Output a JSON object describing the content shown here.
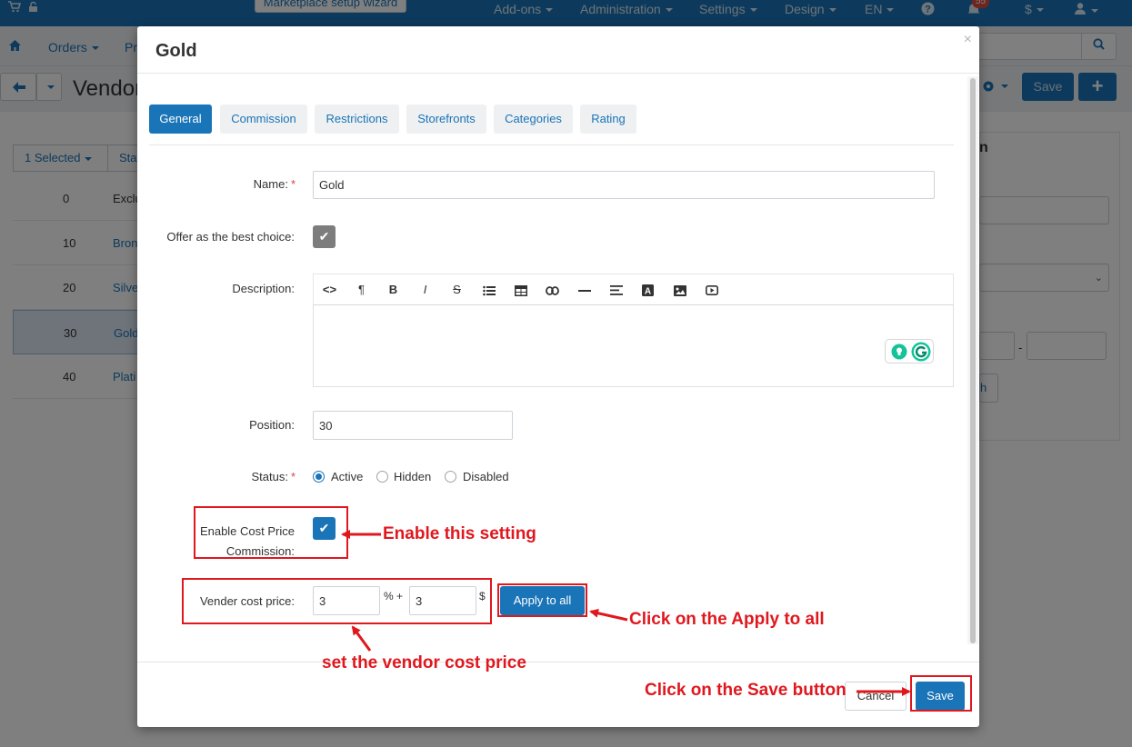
{
  "topbar": {
    "wizard_label": "Marketplace setup wizard",
    "addons": "Add-ons",
    "administration": "Administration",
    "settings": "Settings",
    "design": "Design",
    "language": "EN",
    "notifications_count": "55",
    "currency": "$"
  },
  "subbar": {
    "orders": "Orders",
    "products_partial": "Pr"
  },
  "page": {
    "title": "Vendor",
    "save_label": "Save",
    "selected_label": "1 Selected",
    "status_partial": "Sta"
  },
  "bg_rows": [
    {
      "position": "0",
      "name": "Exclu"
    },
    {
      "position": "10",
      "name": "Bron"
    },
    {
      "position": "20",
      "name": "Silve"
    },
    {
      "position": "30",
      "name": "Gold"
    },
    {
      "position": "40",
      "name": "Plati"
    }
  ],
  "bg_right": {
    "letter_n": "n",
    "dash": "-",
    "btn_partial": "h"
  },
  "modal": {
    "title": "Gold",
    "close_glyph": "×",
    "tabs": [
      "General",
      "Commission",
      "Restrictions",
      "Storefronts",
      "Categories",
      "Rating"
    ],
    "name_label": "Name:",
    "name_value": "Gold",
    "best_choice_label": "Offer as the best choice:",
    "description_label": "Description:",
    "position_label": "Position:",
    "position_value": "30",
    "status_label": "Status:",
    "status_options": [
      "Active",
      "Hidden",
      "Disabled"
    ],
    "status_selected": "Active",
    "cost_price_label_line1": "Enable Cost Price",
    "cost_price_label_line2": "Commission:",
    "vender_cost_label": "Vender cost price:",
    "percent_value": "3",
    "percent_sign": "% +",
    "fixed_value": "3",
    "currency_sign": "$",
    "apply_label": "Apply to all",
    "cancel_label": "Cancel",
    "save_label": "Save"
  },
  "annotations": {
    "enable": "Enable this setting",
    "apply": "Click on the Apply to all",
    "vendor_price": "set the vendor cost price",
    "save": "Click on the Save button"
  },
  "colors": {
    "primary": "#1a74b8",
    "annotation": "#e0181e",
    "overlay": "rgba(0,0,0,0.5)"
  }
}
